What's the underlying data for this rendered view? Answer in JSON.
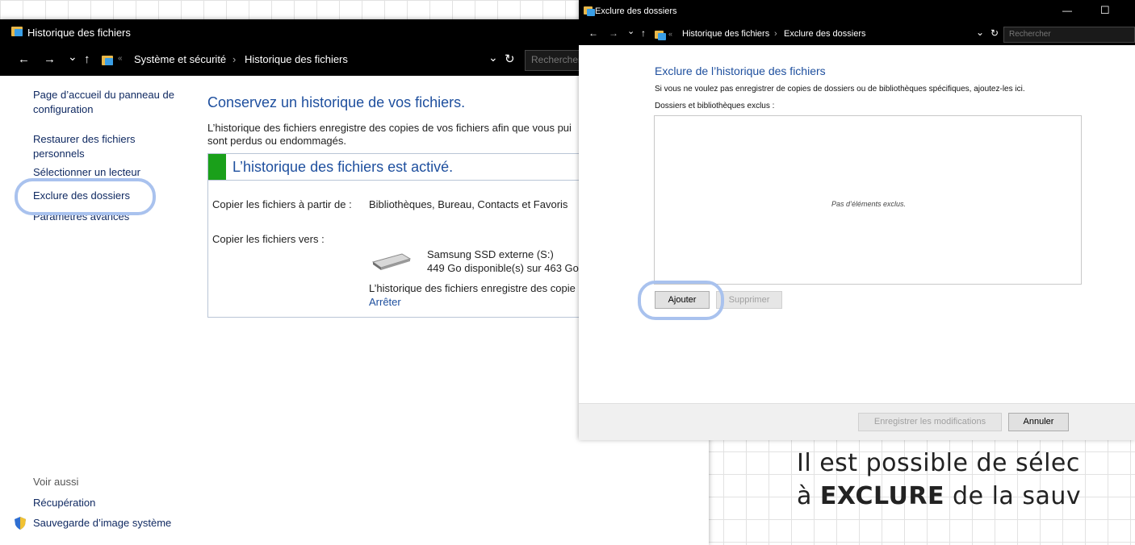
{
  "main_window": {
    "title": "Historique des fichiers",
    "nav": {
      "back": "←",
      "forward": "→",
      "recent": "⌄",
      "up": "↑",
      "refresh": "↻",
      "dropdown": "⌄"
    },
    "breadcrumb": [
      "Système et sécurité",
      "Historique des fichiers"
    ],
    "breadcrumb_sep": "›",
    "search_placeholder": "Rechercher",
    "sidebar": {
      "items": [
        "Page d’accueil du panneau de configuration",
        "Restaurer des fichiers personnels",
        "Sélectionner un lecteur",
        "Exclure des dossiers",
        "Paramètres avancés"
      ],
      "see_also_label": "Voir aussi",
      "see_also": [
        "Récupération",
        "Sauvegarde d’image système"
      ]
    },
    "content": {
      "heading": "Conservez un historique de vos fichiers.",
      "description_line1": "L’historique des fichiers enregistre des copies de vos fichiers afin que vous pui",
      "description_line2": "sont perdus ou endommagés.",
      "status": "L’historique des fichiers est activé.",
      "copy_from_label": "Copier les fichiers à partir de :",
      "copy_from_value": "Bibliothèques, Bureau, Contacts et Favoris",
      "copy_to_label": "Copier les fichiers vers :",
      "drive_name": "Samsung SSD externe (S:)",
      "drive_space": "449 Go disponible(s) sur 463 Go",
      "saving_text": "L’historique des fichiers enregistre des copie",
      "stop_link": "Arrêter"
    }
  },
  "dialog": {
    "title": "Exclure des dossiers",
    "minimize": "—",
    "maximize": "☐",
    "breadcrumb": [
      "Historique des fichiers",
      "Exclure des dossiers"
    ],
    "breadcrumb_sep": "›",
    "search_placeholder": "Rechercher",
    "heading": "Exclure de l’historique des fichiers",
    "instruction": "Si vous ne voulez pas enregistrer de copies de dossiers ou de bibliothèques spécifiques, ajoutez-les ici.",
    "list_label": "Dossiers et bibliothèques exclus :",
    "empty_text": "Pas d’éléments exclus.",
    "add_button": "Ajouter",
    "remove_button": "Supprimer",
    "save_button": "Enregistrer les modifications",
    "cancel_button": "Annuler"
  },
  "overlay": {
    "line1": "Il est possible de sélec",
    "line2_prefix": "à ",
    "line2_bold": "EXCLURE",
    "line2_suffix": " de la sauv"
  },
  "colors": {
    "highlight": "#a9c2ee",
    "link": "#102a62",
    "heading": "#1e4f9e",
    "status_green": "#1aa01a"
  }
}
